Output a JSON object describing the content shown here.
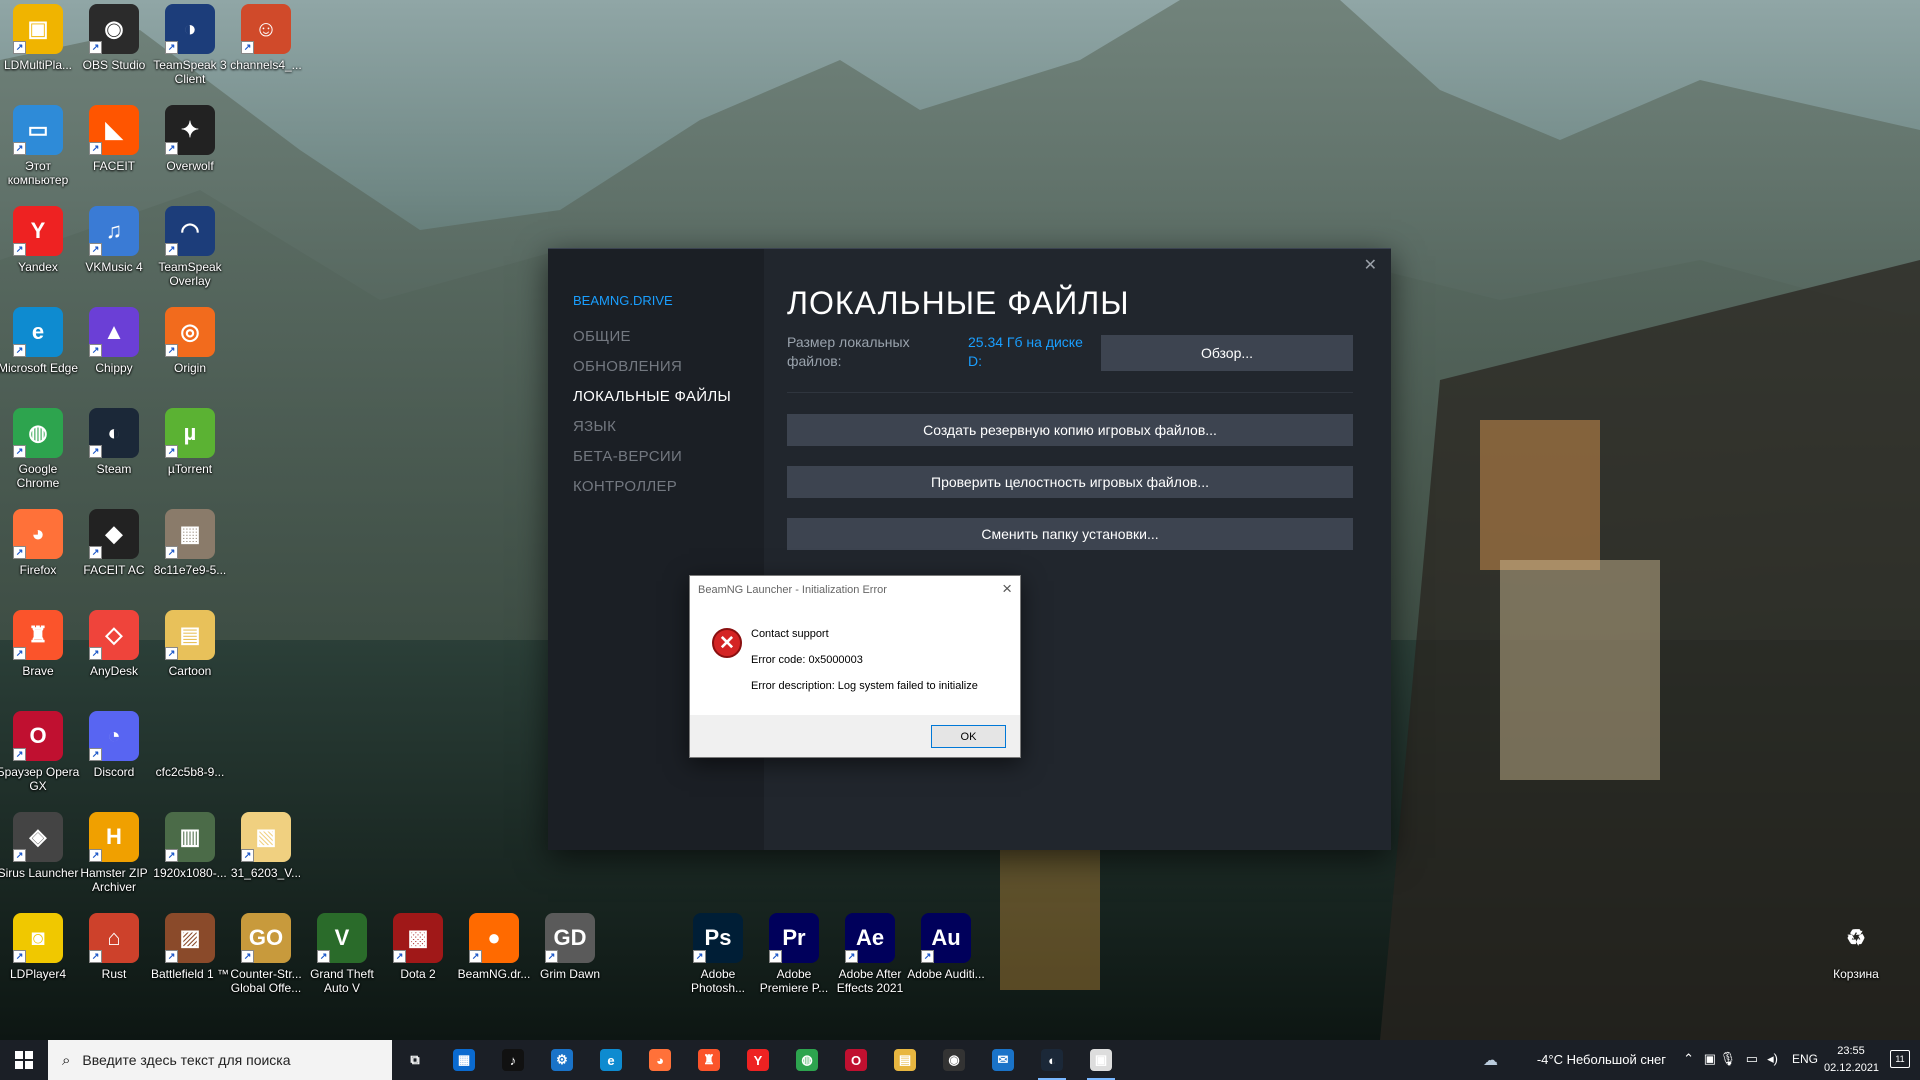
{
  "desktop_icons": [
    {
      "label": "LDMultiPla...",
      "glyph": "▣",
      "color": "#f0b400"
    },
    {
      "label": "OBS Studio",
      "glyph": "◉",
      "color": "#2b2b2b"
    },
    {
      "label": "TeamSpeak 3 Client",
      "glyph": "◑",
      "color": "#1c3d7a"
    },
    {
      "label": "channels4_...",
      "glyph": "☺",
      "color": "#d04a2a"
    },
    {
      "label": "Этот компьютер",
      "glyph": "▭",
      "color": "#2e8bd8"
    },
    {
      "label": "FACEIT",
      "glyph": "◣",
      "color": "#ff5500"
    },
    {
      "label": "Overwolf",
      "glyph": "✦",
      "color": "#222"
    },
    {
      "label": "Yandex",
      "glyph": "Y",
      "color": "#e22"
    },
    {
      "label": "VKMusic 4",
      "glyph": "♫",
      "color": "#3a7bd5"
    },
    {
      "label": "TeamSpeak Overlay",
      "glyph": "◠",
      "color": "#1c3d7a"
    },
    {
      "label": "Microsoft Edge",
      "glyph": "e",
      "color": "#0e8bd0"
    },
    {
      "label": "Chippy",
      "glyph": "▲",
      "color": "#6b3fd6"
    },
    {
      "label": "Origin",
      "glyph": "◎",
      "color": "#f26b1d"
    },
    {
      "label": "Google Chrome",
      "glyph": "◍",
      "color": "#2da44e"
    },
    {
      "label": "Steam",
      "glyph": "◐",
      "color": "#1b2838"
    },
    {
      "label": "µTorrent",
      "glyph": "µ",
      "color": "#5bb233"
    },
    {
      "label": "Firefox",
      "glyph": "◕",
      "color": "#ff7139"
    },
    {
      "label": "FACEIT AC",
      "glyph": "◆",
      "color": "#222"
    },
    {
      "label": "8c11e7e9-5...",
      "glyph": "▦",
      "color": "#8a7b6a"
    },
    {
      "label": "Brave",
      "glyph": "♜",
      "color": "#fb542b"
    },
    {
      "label": "AnyDesk",
      "glyph": "◇",
      "color": "#ef443b"
    },
    {
      "label": "Cartoon",
      "glyph": "▤",
      "color": "#e8c15a"
    },
    {
      "label": "Браузер Opera GX",
      "glyph": "O",
      "color": "#c01030"
    },
    {
      "label": "Discord",
      "glyph": "◔",
      "color": "#5865f2"
    },
    {
      "label": "cfc2c5b8-9...",
      "glyph": "",
      "color": "transparent"
    },
    {
      "label": "Sirus Launcher",
      "glyph": "◈",
      "color": "#444"
    },
    {
      "label": "Hamster ZIP Archiver",
      "glyph": "H",
      "color": "#f0a000"
    },
    {
      "label": "1920x1080-...",
      "glyph": "▥",
      "color": "#4b6b48"
    },
    {
      "label": "31_6203_V...",
      "glyph": "▧",
      "color": "#f0d080"
    },
    {
      "label": "LDPlayer4",
      "glyph": "◙",
      "color": "#f0c800"
    },
    {
      "label": "Rust",
      "glyph": "⌂",
      "color": "#cd412b"
    },
    {
      "label": "Battlefield 1 ™",
      "glyph": "▨",
      "color": "#8a4a2a"
    },
    {
      "label": "Counter-Str... Global Offe...",
      "glyph": "GO",
      "color": "#c89a3c"
    },
    {
      "label": "Grand Theft Auto V",
      "glyph": "V",
      "color": "#2a6b2a"
    },
    {
      "label": "Dota 2",
      "glyph": "▩",
      "color": "#a01818"
    },
    {
      "label": "BeamNG.dr...",
      "glyph": "●",
      "color": "#ff6a00"
    },
    {
      "label": "Grim Dawn",
      "glyph": "GD",
      "color": "#5a5a5a"
    },
    {
      "label": "Adobe Photosh...",
      "glyph": "Ps",
      "color": "#001e36"
    },
    {
      "label": "Adobe Premiere P...",
      "glyph": "Pr",
      "color": "#00005b"
    },
    {
      "label": "Adobe After Effects 2021",
      "glyph": "Ae",
      "color": "#00005b"
    },
    {
      "label": "Adobe Auditi...",
      "glyph": "Au",
      "color": "#00005b"
    },
    {
      "label": "Корзина",
      "glyph": "♻",
      "color": "transparent"
    }
  ],
  "steam": {
    "game_name": "BEAMNG.DRIVE",
    "nav": [
      "ОБЩИЕ",
      "ОБНОВЛЕНИЯ",
      "ЛОКАЛЬНЫЕ ФАЙЛЫ",
      "ЯЗЫК",
      "БЕТА-ВЕРСИИ",
      "КОНТРОЛЛЕР"
    ],
    "active_nav": "ЛОКАЛЬНЫЕ ФАЙЛЫ",
    "title": "ЛОКАЛЬНЫЕ ФАЙЛЫ",
    "size_label": "Размер локальных файлов:",
    "size_value": "25.34 Гб на диске D:",
    "browse_label": "Обзор...",
    "backup_label": "Создать резервную копию игровых файлов...",
    "verify_label": "Проверить целостность игровых файлов...",
    "move_label": "Сменить папку установки...",
    "close_glyph": "✕"
  },
  "error_dialog": {
    "title": "BeamNG Launcher - Initialization Error",
    "line1": "Contact support",
    "line2": "Error code: 0x5000003",
    "line3": "Error description: Log system failed to initialize",
    "ok_label": "OK",
    "icon": "error-icon"
  },
  "taskbar": {
    "search_placeholder": "Введите здесь текст для поиска",
    "pinned": [
      {
        "name": "task-view",
        "glyph": "⧉",
        "color": "transparent"
      },
      {
        "name": "store",
        "glyph": "▦",
        "color": "#0a6ad0"
      },
      {
        "name": "tiktok",
        "glyph": "♪",
        "color": "#111"
      },
      {
        "name": "settings-app",
        "glyph": "⚙",
        "color": "#1a73c8"
      },
      {
        "name": "edge",
        "glyph": "e",
        "color": "#0e8bd0"
      },
      {
        "name": "firefox",
        "glyph": "◕",
        "color": "#ff7139"
      },
      {
        "name": "brave",
        "glyph": "♜",
        "color": "#fb542b"
      },
      {
        "name": "yandex",
        "glyph": "Y",
        "color": "#e22"
      },
      {
        "name": "chrome",
        "glyph": "◍",
        "color": "#2da44e"
      },
      {
        "name": "opera",
        "glyph": "O",
        "color": "#c01030"
      },
      {
        "name": "explorer",
        "glyph": "▤",
        "color": "#e8b640"
      },
      {
        "name": "obs",
        "glyph": "◉",
        "color": "#333"
      },
      {
        "name": "mail",
        "glyph": "✉",
        "color": "#1a73c8"
      },
      {
        "name": "steam",
        "glyph": "◐",
        "color": "#1b2838"
      },
      {
        "name": "beamng-launcher",
        "glyph": "▣",
        "color": "#ddd"
      }
    ],
    "weather": "-4°C  Небольшой снег",
    "lang": "ENG",
    "time": "23:55",
    "date": "02.12.2021",
    "notif_count": "11"
  }
}
